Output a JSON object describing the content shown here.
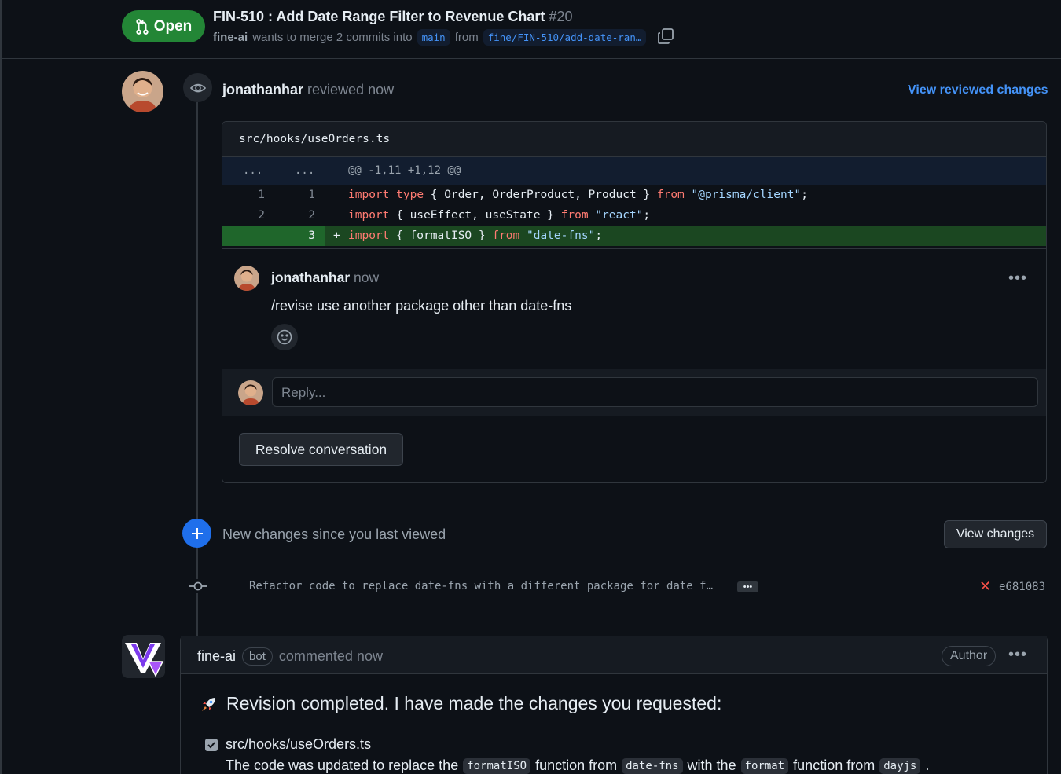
{
  "header": {
    "status_label": "Open",
    "title": "FIN-510 : Add Date Range Filter to Revenue Chart",
    "pr_number": "#20",
    "author": "fine-ai",
    "merge_text": "wants to merge 2 commits into",
    "base_branch": "main",
    "from_text": "from",
    "head_branch": "fine/FIN-510/add-date-ran…"
  },
  "review": {
    "reviewer": "jonathanhar",
    "action": "reviewed now",
    "view_reviewed_label": "View reviewed changes",
    "file_path": "src/hooks/useOrders.ts",
    "hunk": {
      "expand_left": "...",
      "expand_right": "...",
      "header": "@@ -1,11 +1,12 @@"
    },
    "lines": [
      {
        "old": "1",
        "new": "1",
        "sign": "",
        "kw1": "import",
        "kw2": "type",
        "mid": " { Order, OrderProduct, Product } ",
        "kw3": "from",
        "str": "\"@prisma/client\"",
        "end": ";"
      },
      {
        "old": "2",
        "new": "2",
        "sign": "",
        "kw1": "import",
        "kw2": "",
        "mid": " { useEffect, useState } ",
        "kw3": "from",
        "str": "\"react\"",
        "end": ";"
      },
      {
        "old": "",
        "new": "3",
        "sign": "+",
        "kw1": "import",
        "kw2": "",
        "mid": " { formatISO } ",
        "kw3": "from",
        "str": "\"date-fns\"",
        "end": ";"
      }
    ],
    "comment": {
      "author": "jonathanhar",
      "time": "now",
      "body": "/revise use another package other than date-fns",
      "more_label": "•••"
    },
    "reply_placeholder": "Reply...",
    "resolve_label": "Resolve conversation"
  },
  "new_changes": {
    "label": "New changes since you last viewed",
    "button_label": "View changes"
  },
  "commit": {
    "message": "Refactor code to replace date-fns with a different package for date f…",
    "expand_label": "•••",
    "status_icon": "x-icon",
    "sha": "e681083"
  },
  "bot_comment": {
    "author": "fine-ai",
    "bot_label": "bot",
    "time": "commented now",
    "author_badge": "Author",
    "more_label": "•••",
    "title": "Revision completed. I have made the changes you requested:",
    "file": "src/hooks/useOrders.ts",
    "desc_1": "The code was updated to replace the",
    "chip_1": "formatISO",
    "desc_2": "function from",
    "chip_2": "date-fns",
    "desc_3": "with the",
    "chip_3": "format",
    "desc_4": "function from",
    "chip_4": "dayjs",
    "desc_5": "."
  },
  "colors": {
    "open_green": "#238636",
    "link_blue": "#4493f8",
    "added_line_bg": "#1b4721",
    "accent_blue": "#1f6feb",
    "error_red": "#f85149"
  }
}
